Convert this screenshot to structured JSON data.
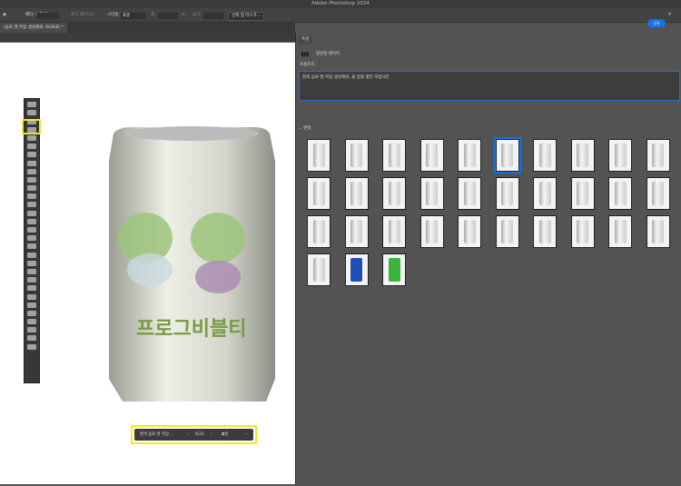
{
  "app": {
    "title": "Adobe Photoshop 2024"
  },
  "options": {
    "feather": "페더: 0 픽셀",
    "antialias": "앤티 앨리어스",
    "style_label": "스타일:",
    "style_value": "표준",
    "width_label": "폭:",
    "height_label": "높이:",
    "select_mask": "선택 및 마스크...",
    "share": "공유"
  },
  "document": {
    "tab": "(음료 캔 목업 생성해줘, RGB/8) *"
  },
  "panel": {
    "tab": "속성",
    "layer_type": "생성형 레이어",
    "prompt_label": "프롬프트:",
    "prompt_value": "흰색 음료 캔 목업 생성해줘, 물 방울 맺힌 목업사진",
    "variations_label": "변형",
    "variation_count": 33,
    "selected_index": 6,
    "special": {
      "31": "#1d4fb5",
      "32": "#3bb53b"
    }
  },
  "artwork": {
    "brand": "프로그비블티"
  },
  "taskbar": {
    "prompt": "흰색 음료 캔 목업 ...",
    "counter": "6/33",
    "generate": "생성",
    "more": "···"
  }
}
